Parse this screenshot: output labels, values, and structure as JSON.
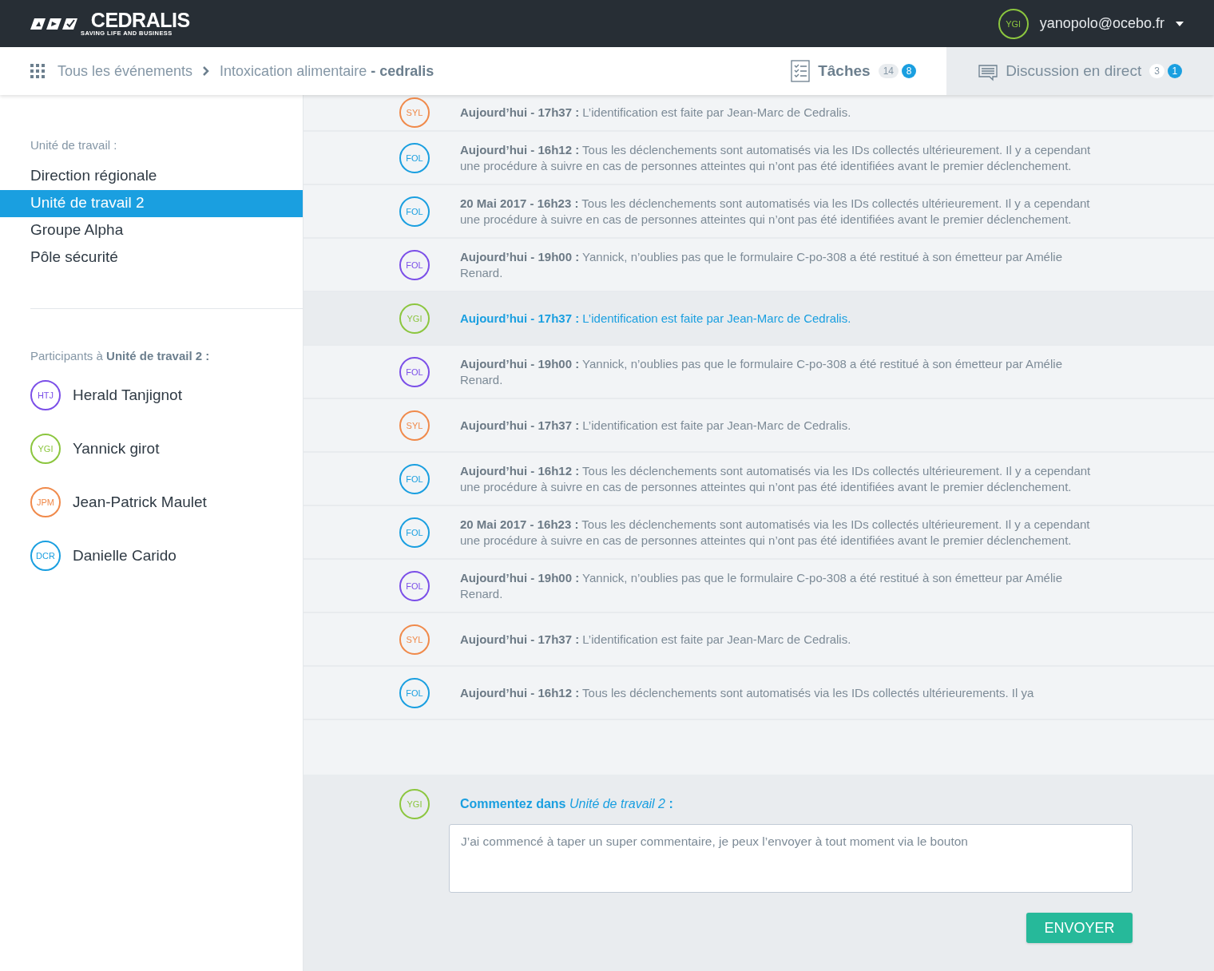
{
  "header": {
    "logo": {
      "name": "CEDRALIS",
      "tagline": "SAVING LIFE AND BUSINESS"
    },
    "user": {
      "initials": "YGI",
      "color": "#8cc63f",
      "email": "yanopolo@ocebo.fr"
    }
  },
  "breadcrumb": {
    "items": [
      "Tous les événements",
      "Intoxication alimentaire **- cedralis**"
    ]
  },
  "tabs": [
    {
      "label": "Tâches",
      "count": "14",
      "badge": "8",
      "kind": "tasks",
      "selected": true
    },
    {
      "label": "Discussion en direct",
      "count": "3",
      "badge": "1",
      "kind": "chat",
      "selected": false
    }
  ],
  "sidebar": {
    "units_label": "Unité de travail :",
    "units": [
      {
        "label": "Direction régionale",
        "selected": false
      },
      {
        "label": "Unité de travail 2",
        "selected": true
      },
      {
        "label": "Groupe Alpha",
        "selected": false
      },
      {
        "label": "Pôle sécurité",
        "selected": false
      }
    ],
    "participants_label": "Participants à **Unité de travail 2 :**",
    "participants": [
      {
        "initials": "HTJ",
        "name": "Herald Tanjignot",
        "color": "#7b4fe8"
      },
      {
        "initials": "YGI",
        "name": "Yannick girot",
        "color": "#8cc63f"
      },
      {
        "initials": "JPM",
        "name": "Jean-Patrick Maulet",
        "color": "#f08a4b"
      },
      {
        "initials": "DCR",
        "name": "Danielle Carido",
        "color": "#1a9fe0"
      }
    ]
  },
  "messages": [
    {
      "initials": "SYL",
      "color": "#f08a4b",
      "text": "**Aujourd’hui - 17h37 :** L’identification est faite par Jean-Marc de Cedralis.",
      "selected": false
    },
    {
      "initials": "FOL",
      "color": "#1a9fe0",
      "text": "**Aujourd’hui - 16h12 :** Tous les déclenchements sont automatisés via les IDs collectés ultérieurement. Il y a cependant une procédure à suivre en cas de personnes atteintes qui n’ont pas été identifiées avant le premier déclenchement.",
      "selected": false
    },
    {
      "initials": "FOL",
      "color": "#1a9fe0",
      "text": "**20 Mai 2017 - 16h23 :** Tous les déclenchements sont automatisés via les IDs collectés ultérieurement. Il y a cependant une procédure à suivre en cas de personnes atteintes qui n’ont pas été identifiées avant le premier déclenchement.",
      "selected": false
    },
    {
      "initials": "FOL",
      "color": "#7b4fe8",
      "text": "**Aujourd’hui - 19h00 :** Yannick, n’oublies pas que le formulaire C-po-308 a été restitué à son émetteur par Amélie Renard.",
      "selected": false
    },
    {
      "initials": "YGI",
      "color": "#8cc63f",
      "text": "**Aujourd’hui - 17h37 :** L’identification est faite par Jean-Marc de Cedralis.",
      "selected": true
    },
    {
      "initials": "FOL",
      "color": "#7b4fe8",
      "text": "**Aujourd’hui - 19h00 :** Yannick, n’oublies pas que le formulaire C-po-308 a été restitué à son émetteur par Amélie Renard.",
      "selected": false
    },
    {
      "initials": "SYL",
      "color": "#f08a4b",
      "text": "**Aujourd’hui - 17h37 :** L’identification est faite par Jean-Marc de Cedralis.",
      "selected": false
    },
    {
      "initials": "FOL",
      "color": "#1a9fe0",
      "text": "**Aujourd’hui - 16h12 :** Tous les déclenchements sont automatisés via les IDs collectés ultérieurement. Il y a cependant une procédure à suivre en cas de personnes atteintes qui n’ont pas été identifiées avant le premier déclenchement.",
      "selected": false
    },
    {
      "initials": "FOL",
      "color": "#1a9fe0",
      "text": "**20 Mai 2017 - 16h23 :** Tous les déclenchements sont automatisés via les IDs collectés ultérieurement. Il y a cependant une procédure à suivre en cas de personnes atteintes qui n’ont pas été identifiées avant le premier déclenchement.",
      "selected": false
    },
    {
      "initials": "FOL",
      "color": "#7b4fe8",
      "text": "**Aujourd’hui - 19h00 :** Yannick, n’oublies pas que le formulaire C-po-308 a été restitué à son émetteur par Amélie Renard.",
      "selected": false
    },
    {
      "initials": "SYL",
      "color": "#f08a4b",
      "text": "**Aujourd’hui - 17h37 :** L’identification est faite par Jean-Marc de Cedralis.",
      "selected": false
    },
    {
      "initials": "FOL",
      "color": "#1a9fe0",
      "text": "**Aujourd’hui - 16h12 :** Tous les déclenchements sont automatisés via les IDs collectés ultérieurements. Il ya",
      "selected": false
    }
  ],
  "composer": {
    "initials": "YGI",
    "color": "#8cc63f",
    "label": "**Commentez dans** *Unité de travail 2* **:**",
    "value": "J’ai commencé à taper un super commentaire, je peux l’envoyer à tout moment via le bouton",
    "button": "ENVOYER"
  }
}
